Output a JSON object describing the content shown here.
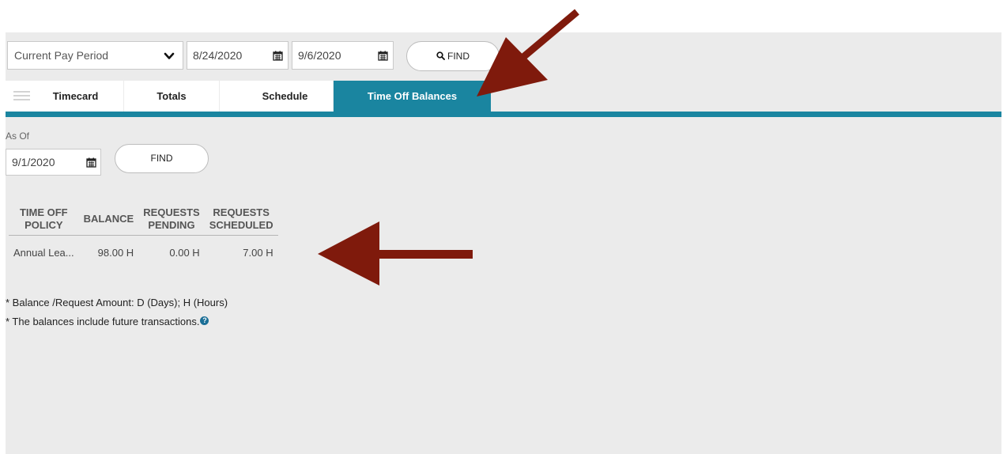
{
  "toolbar": {
    "period_select": "Current Pay Period",
    "start_date": "8/24/2020",
    "end_date": "9/6/2020",
    "find_label": "FIND"
  },
  "tabs": [
    {
      "label": "Timecard"
    },
    {
      "label": "Totals"
    },
    {
      "label": "Schedule"
    },
    {
      "label": "Time Off Balances",
      "active": true
    }
  ],
  "as_of": {
    "label": "As Of",
    "date": "9/1/2020",
    "find_label": "FIND"
  },
  "balances_table": {
    "headers": [
      [
        "TIME OFF",
        "POLICY"
      ],
      [
        "BALANCE"
      ],
      [
        "REQUESTS",
        "PENDING"
      ],
      [
        "REQUESTS",
        "SCHEDULED"
      ]
    ],
    "rows": [
      {
        "policy": "Annual Lea...",
        "balance": "98.00 H",
        "pending": "0.00 H",
        "scheduled": "7.00 H"
      }
    ]
  },
  "notes": {
    "line1": "* Balance /Request Amount: D (Days); H (Hours)",
    "line2": "* The balances include future transactions."
  },
  "icons": {
    "chevron": "chevron-down-icon",
    "calendar": "calendar-icon",
    "search": "search-icon",
    "menu": "menu-icon",
    "help": "help-icon"
  },
  "colors": {
    "accent": "#1a85a0",
    "arrow": "#7f1a0c",
    "background": "#ebebeb"
  }
}
